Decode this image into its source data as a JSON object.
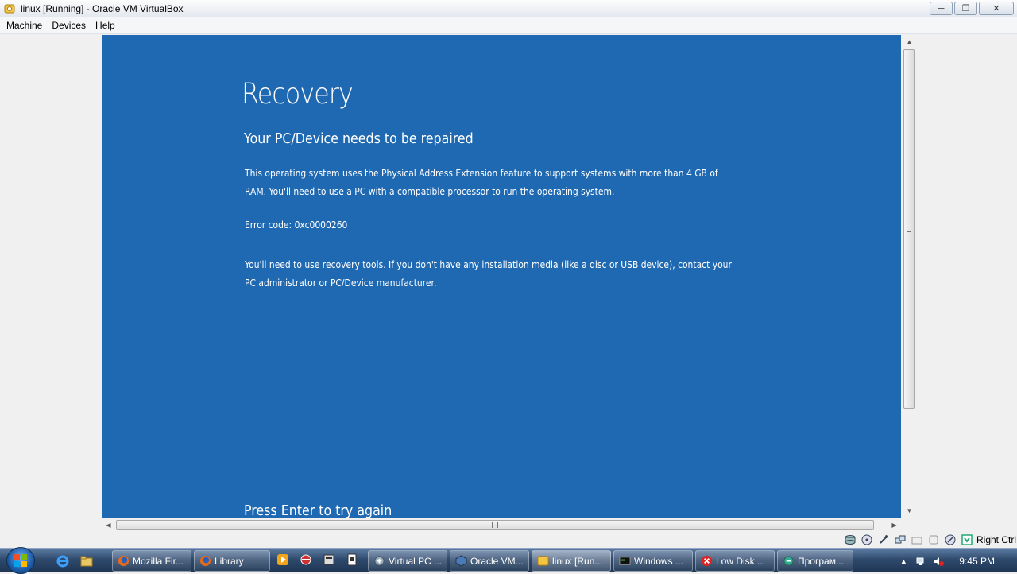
{
  "window": {
    "title": "linux [Running] - Oracle VM VirtualBox",
    "controls": [
      "minimize",
      "maximize",
      "close"
    ]
  },
  "menu": [
    "Machine",
    "Devices",
    "Help"
  ],
  "recovery": {
    "title": "Recovery",
    "subtitle": "Your PC/Device needs to be repaired",
    "body": "This operating system uses the Physical Address Extension feature to support systems with more than 4 GB of RAM.  You'll need to use a PC with a compatible processor to run the operating system.",
    "error": "Error code: 0xc0000260",
    "tools": "You'll need to use recovery tools. If you don't have any installation media (like a disc or USB device), contact your PC administrator or PC/Device manufacturer.",
    "prompt": "Press Enter to try again",
    "background": "#1f69b2"
  },
  "statusbar": {
    "host_key": "Right Ctrl"
  },
  "taskbar": {
    "tasks": [
      {
        "label": "Mozilla Fir...",
        "icon": "firefox-icon"
      },
      {
        "label": "Library",
        "icon": "firefox-icon"
      },
      {
        "label": "Virtual PC ...",
        "icon": "virtualpc-icon"
      },
      {
        "label": "Oracle VM...",
        "icon": "virtualbox-icon"
      },
      {
        "label": "linux [Run...",
        "icon": "virtualbox-vm-icon"
      },
      {
        "label": "Windows ...",
        "icon": "console-icon"
      },
      {
        "label": "Low Disk ...",
        "icon": "error-icon"
      },
      {
        "label": "Програм...",
        "icon": "program-icon"
      }
    ],
    "clock": "9:45 PM"
  }
}
